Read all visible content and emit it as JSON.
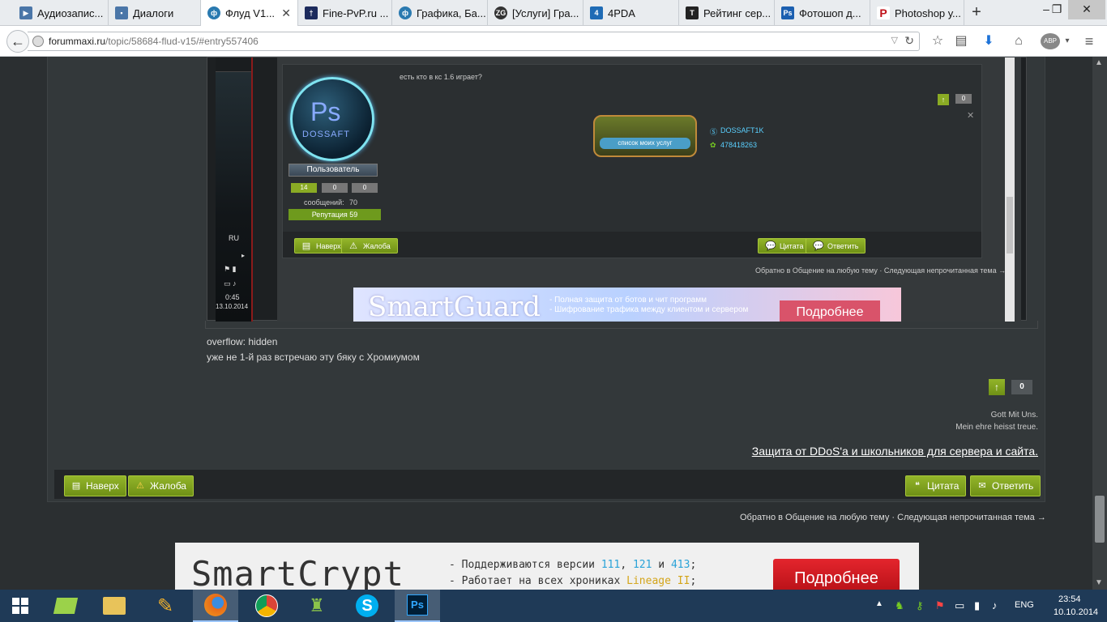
{
  "browser": {
    "tabs": [
      {
        "title": "Аудиозапис...",
        "icon_color": "#4a76a8",
        "icon": "play-icon"
      },
      {
        "title": "Диалоги",
        "icon_color": "#4a76a8",
        "icon": "chat-icon"
      },
      {
        "title": "Флуд V1...",
        "icon_color": "#2a7ab0",
        "icon": "forum-icon",
        "active": true
      },
      {
        "title": "Fine-PvP.ru ...",
        "icon_color": "#1b2a5c",
        "icon": "sword-icon"
      },
      {
        "title": "Графика, Ба...",
        "icon_color": "#2a7ab0",
        "icon": "forum-icon"
      },
      {
        "title": "[Услуги] Гра...",
        "icon_color": "#333",
        "icon": "zg-icon"
      },
      {
        "title": "4PDA",
        "icon_color": "#1f6bb5",
        "icon": "4pda-icon"
      },
      {
        "title": "Рейтинг сер...",
        "icon_color": "#222",
        "icon": "top-icon"
      },
      {
        "title": "Фотошоп д...",
        "icon_color": "#1b5fb0",
        "icon": "ps-icon"
      },
      {
        "title": "Photoshop у...",
        "icon_color": "#c0121a",
        "icon": "p-icon"
      }
    ],
    "url_host": "forummaxi.ru",
    "url_path": "/topic/58684-flud-v15/#entry557406",
    "abp_label": "ABP"
  },
  "embedded_shot": {
    "post_text": "есть кто в кс 1.6 играет?",
    "avatar_text_top": "Ps",
    "avatar_text_bottom": "DOSSAFT",
    "role": "Пользователь",
    "stats": [
      "14",
      "0",
      "0"
    ],
    "messages_label": "сообщений:",
    "messages_value": "70",
    "reputation": "Репутация 59",
    "vote_count": "0",
    "services_label": "список моих услуг",
    "skype": "DOSSAFT1K",
    "icq": "478418263",
    "btn_top": "Наверх",
    "btn_report": "Жалоба",
    "btn_quote": "Цитата",
    "btn_reply": "Ответить",
    "nav_text": "Обратно в Общение на любую тему · Следующая непрочитанная тема →",
    "lang": "RU",
    "time": "0:45",
    "date": "13.10.2014",
    "ad_title": "SmartGuard",
    "ad_lines": [
      "- Полная защита от ботов и чит программ",
      "- Шифрование трафика между клиентом и сервером"
    ],
    "ad_button": "Подробнее"
  },
  "post": {
    "line1": "overflow: hidden",
    "line2": "уже не 1-й раз встречаю эту бяку с Хромиумом",
    "vote_count": "0",
    "sig1": "Gott Mit Uns.",
    "sig2": "Mein ehre heisst treue.",
    "sig_link": "Защита от DDoS'а и школьников для сервера и сайта."
  },
  "actions": {
    "top": "Наверх",
    "report": "Жалоба",
    "quote": "Цитата",
    "reply": "Ответить"
  },
  "nav": {
    "back": "Обратно в Общение на любую тему",
    "next": "Следующая непрочитанная тема →"
  },
  "ad": {
    "title": "SmartCrypt",
    "line1_a": "- Поддерживаются версии ",
    "v1": "111",
    "v2": "121",
    "line1_and": " и ",
    "v3": "413",
    "line1_end": ";",
    "line2_a": "- Работает на всех хрониках ",
    "line2_b": "Lineage II",
    "line2_end": ";",
    "button": "Подробнее"
  },
  "taskbar": {
    "lang": "ENG",
    "time": "23:54",
    "date": "10.10.2014"
  }
}
